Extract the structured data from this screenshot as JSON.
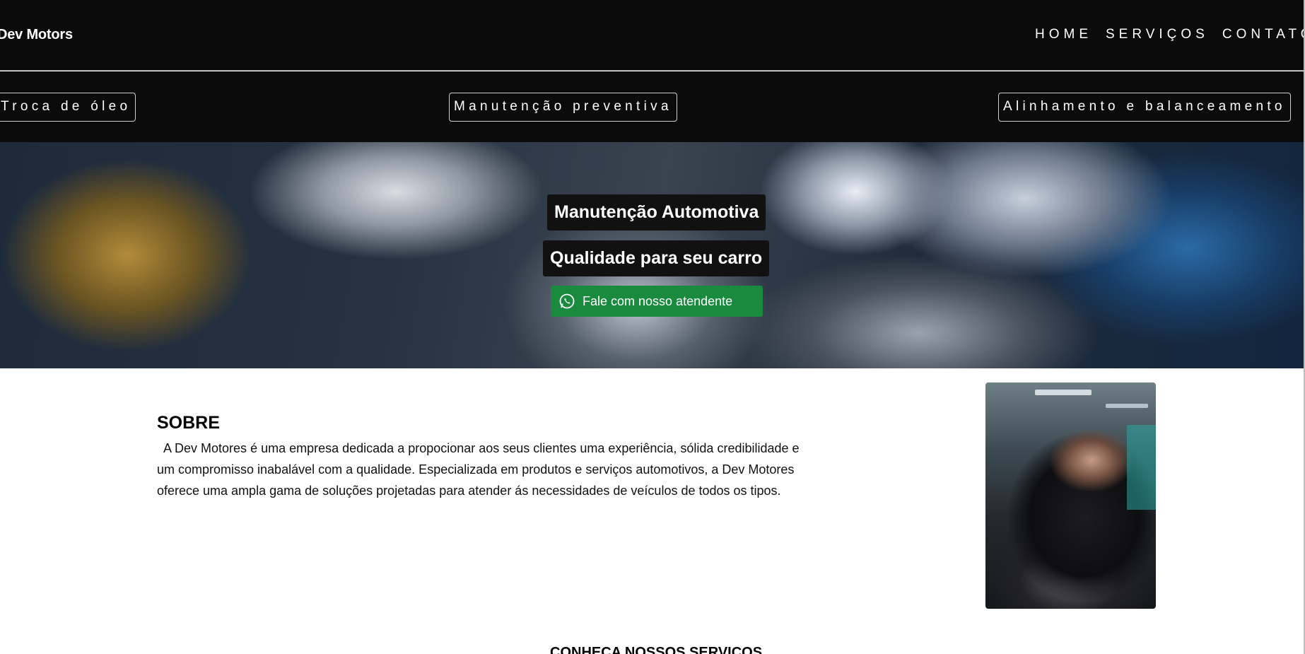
{
  "header": {
    "brand": "Dev Motors",
    "nav": [
      "HOME",
      "SERVIÇOS",
      "CONTATO"
    ]
  },
  "services_bar": [
    "Troca de óleo",
    "Manutenção preventiva",
    "Alinhamento e balanceamento"
  ],
  "hero": {
    "title": "Manutenção Automotiva",
    "subtitle": "Qualidade para seu carro",
    "cta_label": "Fale com nosso atendente",
    "cta_icon": "whatsapp-icon"
  },
  "about": {
    "title": "SOBRE",
    "text": "A Dev Motores é uma empresa dedicada a propocionar aos seus clientes uma experiência, sólida credibilidade e um compromisso inabalável com a qualidade. Especializada em produtos e serviços automotivos, a Dev Motores oferece uma ampla gama de soluções projetadas para atender ás necessidades de veículos de todos os tipos."
  },
  "services_section": {
    "title": "CONHEÇA NOSSOS SERVIÇOS"
  },
  "colors": {
    "header_bg": "#0b0b0b",
    "cta_green": "#1a8a3f",
    "text_dark": "#111111"
  }
}
